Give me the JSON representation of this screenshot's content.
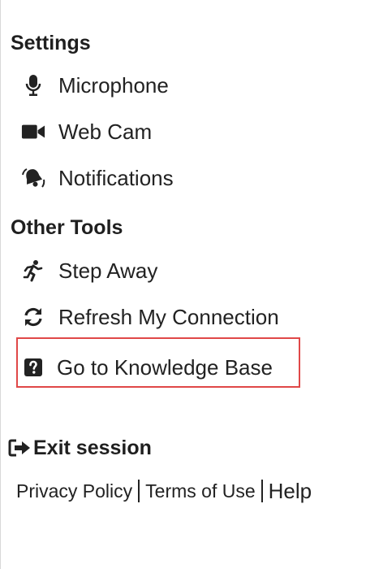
{
  "settings": {
    "heading": "Settings",
    "items": [
      {
        "label": "Microphone",
        "icon": "microphone-icon"
      },
      {
        "label": "Web Cam",
        "icon": "video-camera-icon"
      },
      {
        "label": "Notifications",
        "icon": "bell-icon"
      }
    ]
  },
  "other_tools": {
    "heading": "Other Tools",
    "items": [
      {
        "label": "Step Away",
        "icon": "running-person-icon"
      },
      {
        "label": "Refresh My Connection",
        "icon": "refresh-icon"
      },
      {
        "label": "Go to Knowledge Base",
        "icon": "question-square-icon",
        "highlighted": true
      }
    ]
  },
  "exit": {
    "label": "Exit session",
    "icon": "sign-out-icon"
  },
  "footer": {
    "links": [
      "Privacy Policy",
      "Terms of Use",
      "Help"
    ]
  },
  "colors": {
    "text": "#222222",
    "highlight_border": "#e04848"
  }
}
